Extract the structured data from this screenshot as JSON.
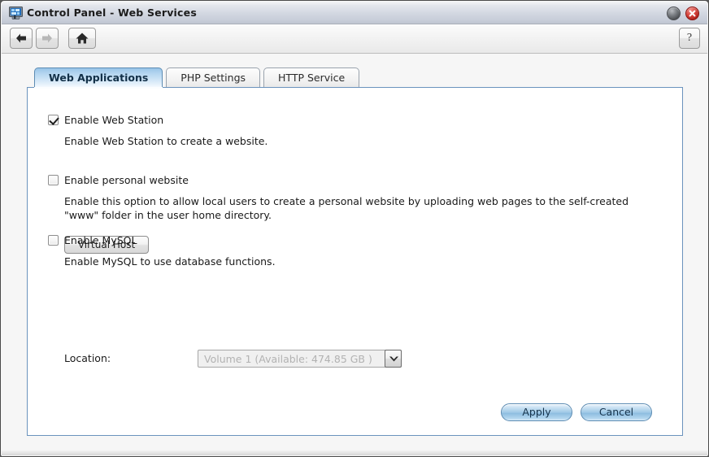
{
  "window": {
    "title": "Control Panel - Web Services",
    "icon": "control-panel-icon",
    "minimize_label": "",
    "close_label": ""
  },
  "toolbar": {
    "back_icon": "arrow-left-icon",
    "forward_icon": "arrow-right-icon",
    "home_icon": "home-icon",
    "help_label": "?"
  },
  "tabs": [
    {
      "label": "Web Applications",
      "active": true
    },
    {
      "label": "PHP Settings",
      "active": false
    },
    {
      "label": "HTTP Service",
      "active": false
    }
  ],
  "form": {
    "web_station": {
      "label": "Enable Web Station",
      "checked": true,
      "description": "Enable Web Station to create a website."
    },
    "virtual_host_button": "Virtual Host",
    "personal_website": {
      "label": "Enable personal website",
      "checked": false,
      "description": "Enable this option to allow local users to create a personal website by uploading web pages to the self-created \"www\" folder in the user home directory."
    },
    "mysql": {
      "label": "Enable MySQL",
      "checked": false,
      "description": "Enable MySQL to use database functions."
    },
    "location": {
      "label": "Location:",
      "value": "Volume 1 (Available: 474.85 GB )",
      "disabled": true
    }
  },
  "footer": {
    "apply_label": "Apply",
    "cancel_label": "Cancel"
  },
  "colors": {
    "accent_blue": "#6b93bd",
    "active_tab_blue": "#99c5e8",
    "close_red": "#ad1f19",
    "disabled_text": "#b2b2b2"
  }
}
